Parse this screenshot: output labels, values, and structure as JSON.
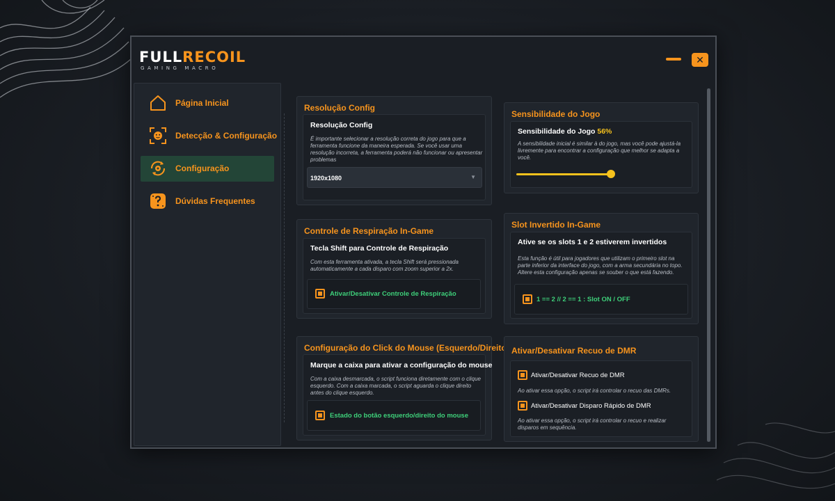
{
  "logo": {
    "part1": "FULL",
    "part2": "RECOIL",
    "subtitle": "GAMING MACRO"
  },
  "window": {
    "minimize_label": "minimize",
    "close_symbol": "✕"
  },
  "sidebar": {
    "items": [
      {
        "label": "Página Inicial",
        "icon": "home-icon"
      },
      {
        "label": "Detecção & Configuração",
        "icon": "face-scan-icon"
      },
      {
        "label": "Configuração",
        "icon": "sync-gear-icon",
        "active": true
      },
      {
        "label": "Dúvidas Frequentes",
        "icon": "question-icon"
      }
    ]
  },
  "resolution": {
    "panel_title": "Resolução Config",
    "card_title": "Resolução Config",
    "desc": "É importante selecionar a resolução correta do jogo para que a ferramenta funcione da maneira esperada. Se você usar uma resolução incorreta, a ferramenta poderá não funcionar ou apresentar problemas",
    "selected": "1920x1080"
  },
  "sensitivity": {
    "panel_title": "Sensibilidade do Jogo",
    "card_title": "Sensibilidade do Jogo",
    "value_text": "56%",
    "value": 0.56,
    "desc": "A sensibilidade inicial é similar à do jogo, mas você pode ajustá-la livremente para encontrar a configuração que melhor se adapta a você."
  },
  "breath": {
    "panel_title": "Controle de Respiração In-Game",
    "card_title": "Tecla Shift para Controle de Respiração",
    "desc": "Com esta ferramenta ativada, a tecla Shift será pressionada automaticamente a cada disparo com zoom superior a 2x.",
    "option_label": "Ativar/Desativar Controle de Respiração",
    "checked": true
  },
  "slot": {
    "panel_title": "Slot Invertido In-Game",
    "card_title": "Ative se os slots 1 e 2 estiverem invertidos",
    "desc": "Esta função é útil para jogadores que utilizam o primeiro slot na parte inferior da interface do jogo, com a arma secundária no topo. Altere esta configuração apenas se souber o que está fazendo.",
    "option_label": "1 == 2 // 2 == 1 : Slot ON / OFF",
    "checked": true
  },
  "mouse": {
    "panel_title": "Configuração do Click do Mouse (Esquerdo/Direito)",
    "card_title": "Marque a caixa para ativar a configuração do mouse",
    "desc": "Com a caixa desmarcada, o script funciona diretamente com o clique esquerdo. Com a caixa marcada, o script aguarda o clique direito antes do clique esquerdo.",
    "option_label": "Estado do botão esquerdo/direito do mouse",
    "checked": true
  },
  "dmr": {
    "panel_title": "Ativar/Desativar Recuo de DMR",
    "option1_label": "Ativar/Desativar Recuo de DMR",
    "option1_desc": "Ao ativar essa opção, o script irá controlar o recuo das DMRs.",
    "option2_label": "Ativar/Desativar Disparo Rápido de DMR",
    "option2_desc": "Ao ativar essa opção, o script irá controlar o recuo e realizar disparos em sequência.",
    "checked1": true,
    "checked2": true
  },
  "colors": {
    "accent": "#f7941d",
    "green": "#3ed07a",
    "yellow": "#f7c21d",
    "active_bg": "#234537"
  }
}
